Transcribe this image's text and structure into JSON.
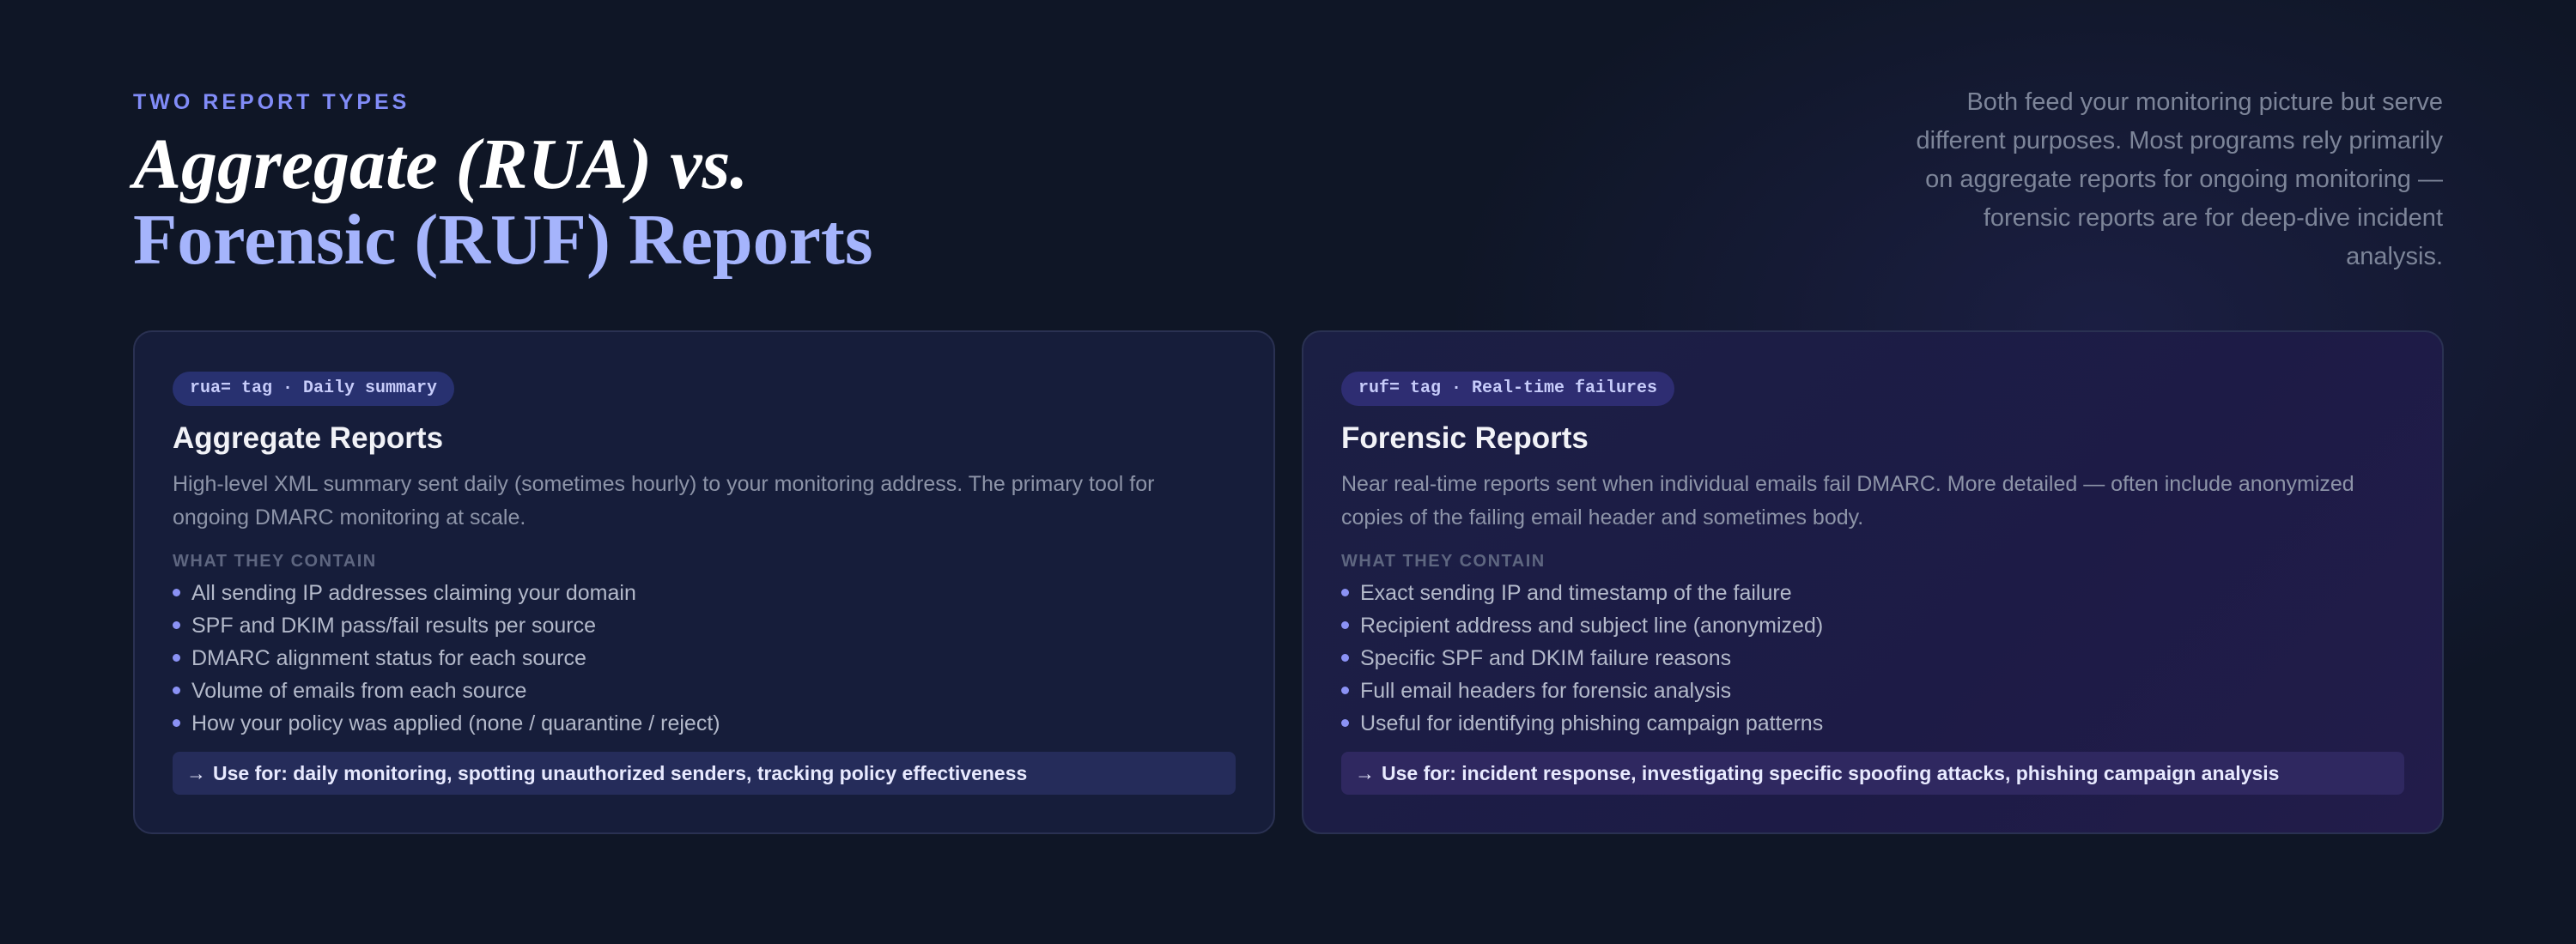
{
  "header": {
    "eyebrow": "TWO REPORT TYPES",
    "title_line1": "Aggregate (RUA) vs.",
    "title_line2": "Forensic (RUF) Reports",
    "intro": "Both feed your monitoring picture but serve different purposes. Most programs rely primarily on aggregate reports for ongoing monitoring — forensic reports are for deep-dive incident analysis."
  },
  "cards": [
    {
      "tag": "rua= tag · Daily summary",
      "title": "Aggregate Reports",
      "description": "High-level XML summary sent daily (sometimes hourly) to your monitoring address. The primary tool for ongoing DMARC monitoring at scale.",
      "section_label": "WHAT THEY CONTAIN",
      "items": [
        "All sending IP addresses claiming your domain",
        "SPF and DKIM pass/fail results per source",
        "DMARC alignment status for each source",
        "Volume of emails from each source",
        "How your policy was applied (none / quarantine / reject)"
      ],
      "arrow": "→",
      "use_for": "Use for: daily monitoring, spotting unauthorized senders, tracking policy effectiveness"
    },
    {
      "tag": "ruf= tag · Real-time failures",
      "title": "Forensic Reports",
      "description": "Near real-time reports sent when individual emails fail DMARC. More detailed — often include anonymized copies of the failing email header and sometimes body.",
      "section_label": "WHAT THEY CONTAIN",
      "items": [
        "Exact sending IP and timestamp of the failure",
        "Recipient address and subject line (anonymized)",
        "Specific SPF and DKIM failure reasons",
        "Full email headers for forensic analysis",
        "Useful for identifying phishing campaign patterns"
      ],
      "arrow": "→",
      "use_for": "Use for: incident response, investigating specific spoofing attacks, phishing campaign analysis"
    }
  ],
  "colors": {
    "background": "#0f1626",
    "accent": "#818cf8",
    "title_accent": "#a5b4fc"
  }
}
